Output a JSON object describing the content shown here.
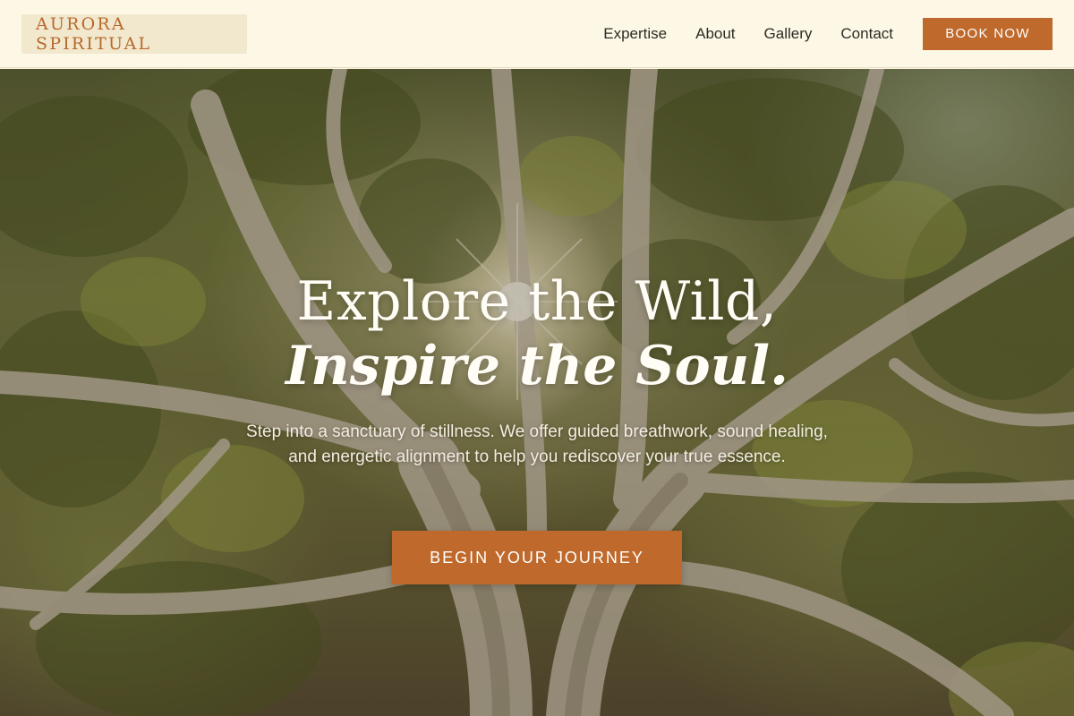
{
  "nav": {
    "logo": "AURORA SPIRITUAL",
    "links": [
      {
        "label": "Expertise"
      },
      {
        "label": "About"
      },
      {
        "label": "Gallery"
      },
      {
        "label": "Contact"
      }
    ],
    "book_label": "BOOK NOW"
  },
  "hero": {
    "headline_line1": "Explore the Wild,",
    "headline_line2": "Inspire the Soul.",
    "subtext": "Step into a sanctuary of stillness. We offer guided breathwork, sound healing, and energetic alignment to help you rediscover your true essence.",
    "cta_label": "BEGIN YOUR JOURNEY",
    "background_image": "tree-canopy-sunburst"
  },
  "colors": {
    "accent": "#bf6a2c",
    "nav_bg": "#fdf8e6",
    "logo_bg": "#f1e8cd",
    "logo_text": "#b8692c",
    "nav_text": "#2f2b24"
  }
}
